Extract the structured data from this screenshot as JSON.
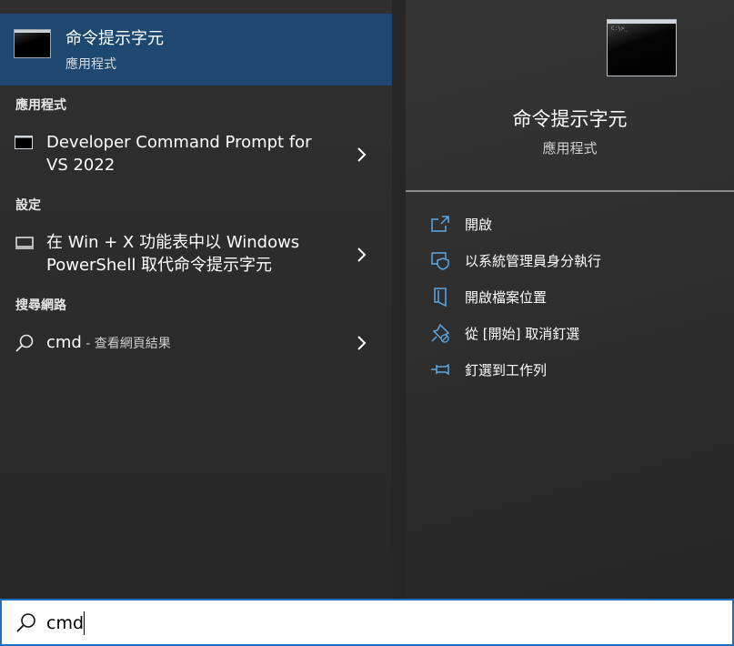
{
  "best_match": {
    "title": "命令提示字元",
    "subtitle": "應用程式"
  },
  "sections": {
    "apps": "應用程式",
    "settings": "設定",
    "web": "搜尋網路"
  },
  "apps_items": [
    {
      "line1": "Developer Command Prompt for",
      "line2": "VS 2022"
    }
  ],
  "settings_items": [
    {
      "line1": "在 Win + X 功能表中以 Windows",
      "line2": "PowerShell 取代命令提示字元"
    }
  ],
  "web_items": [
    {
      "query": "cmd",
      "suffix": " - 查看網頁結果"
    }
  ],
  "detail": {
    "tile_glyph": "C:\\>_",
    "title": "命令提示字元",
    "subtitle": "應用程式",
    "actions": [
      {
        "label": "開啟",
        "icon": "open-icon"
      },
      {
        "label": "以系統管理員身分執行",
        "icon": "shield-icon"
      },
      {
        "label": "開啟檔案位置",
        "icon": "folder-icon"
      },
      {
        "label": "從 [開始] 取消釘選",
        "icon": "unpin-icon"
      },
      {
        "label": "釘選到工作列",
        "icon": "pin-icon"
      }
    ]
  },
  "search": {
    "value": "cmd"
  },
  "colors": {
    "accent": "#1e4870",
    "search_border": "#1f6fc0",
    "icon_blue": "#5aa8e6"
  }
}
